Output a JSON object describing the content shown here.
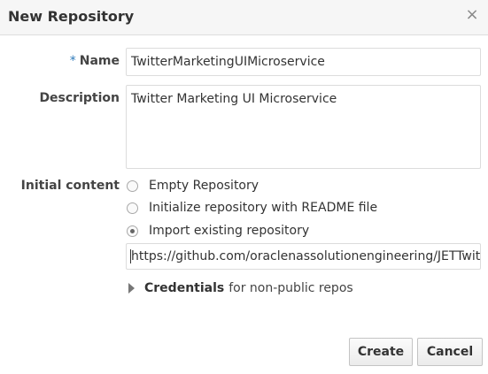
{
  "dialog": {
    "title": "New Repository",
    "close_glyph": "×"
  },
  "form": {
    "required_mark": "*",
    "name_label": "Name",
    "name_value": "TwitterMarketingUIMicroservice",
    "description_label": "Description",
    "description_value": "Twitter Marketing UI Microservice",
    "initial_content_label": "Initial content",
    "options": [
      {
        "label": "Empty Repository",
        "selected": false
      },
      {
        "label": "Initialize repository with README file",
        "selected": false
      },
      {
        "label": "Import existing repository",
        "selected": true
      }
    ],
    "import_url_value": "https://github.com/oraclenassolutionengineering/JETTwitterQu",
    "credentials_label": "Credentials",
    "credentials_note": "for non-public repos"
  },
  "footer": {
    "create_label": "Create",
    "cancel_label": "Cancel"
  }
}
